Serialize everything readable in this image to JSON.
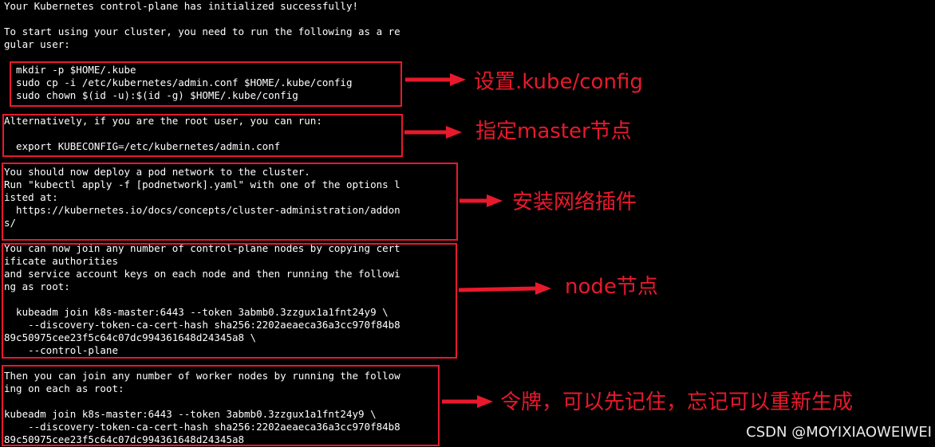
{
  "terminal": {
    "lines": [
      "Your Kubernetes control-plane has initialized successfully!",
      "",
      "To start using your cluster, you need to run the following as a re",
      "gular user:",
      "",
      "  mkdir -p $HOME/.kube",
      "  sudo cp -i /etc/kubernetes/admin.conf $HOME/.kube/config",
      "  sudo chown $(id -u):$(id -g) $HOME/.kube/config",
      "",
      "Alternatively, if you are the root user, you can run:",
      "",
      "  export KUBECONFIG=/etc/kubernetes/admin.conf",
      "",
      "You should now deploy a pod network to the cluster.",
      "Run \"kubectl apply -f [podnetwork].yaml\" with one of the options l",
      "isted at:",
      "  https://kubernetes.io/docs/concepts/cluster-administration/addon",
      "s/",
      "",
      "You can now join any number of control-plane nodes by copying cert",
      "ificate authorities",
      "and service account keys on each node and then running the followi",
      "ng as root:",
      "",
      "  kubeadm join k8s-master:6443 --token 3abmb0.3zzgux1a1fnt24y9 \\",
      "    --discovery-token-ca-cert-hash sha256:2202aeaeca36a3cc970f84b8",
      "89c50975cee23f5c64c07dc994361648d24345a8 \\",
      "    --control-plane",
      "",
      "Then you can join any number of worker nodes by running the follow",
      "ing on each as root:",
      "",
      "kubeadm join k8s-master:6443 --token 3abmb0.3zzgux1a1fnt24y9 \\",
      "    --discovery-token-ca-cert-hash sha256:2202aeaeca36a3cc970f84b8",
      "89c50975cee23f5c64c07dc994361648d24345a8"
    ]
  },
  "annotations": [
    {
      "label": "设置.kube/config"
    },
    {
      "label": "指定master节点"
    },
    {
      "label": "安装网络插件"
    },
    {
      "label": "node节点"
    },
    {
      "label": "令牌，可以先记住，忘记可以重新生成"
    }
  ],
  "watermark": "CSDN @MOYIXIAOWEIWEI",
  "colors": {
    "background": "#000000",
    "text": "#ffffff",
    "annotation": "#e8192c"
  }
}
